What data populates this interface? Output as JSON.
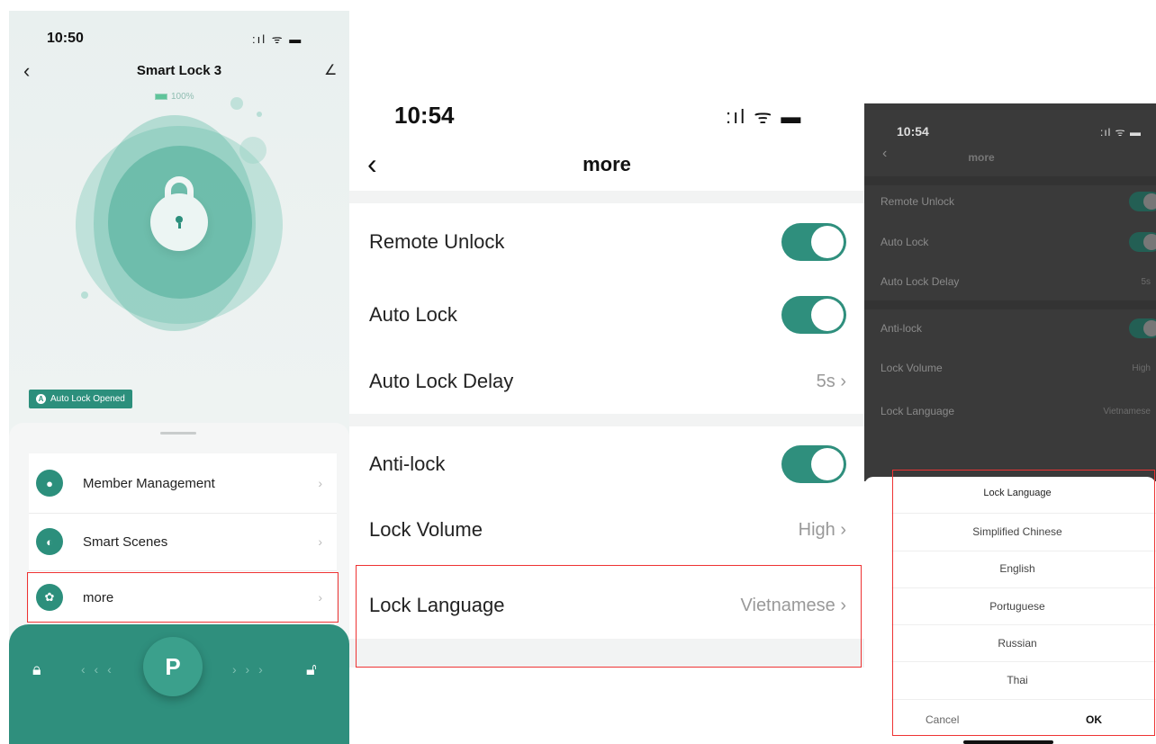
{
  "panel1": {
    "status_time": "10:50",
    "status_icons": ":ıl ᯤ ▬",
    "title": "Smart Lock 3",
    "battery": "100%",
    "auto_lock_badge": "Auto Lock Opened",
    "menu": [
      {
        "label": "Member Management",
        "icon": "person-icon"
      },
      {
        "label": "Smart Scenes",
        "icon": "toggle-icon"
      },
      {
        "label": "more",
        "icon": "gear-icon"
      }
    ],
    "bottom_bar": {
      "key_glyph": "P",
      "left_arrows": "‹ ‹ ‹",
      "right_arrows": "› › ›"
    },
    "colors": {
      "accent": "#2f8f7d",
      "highlight": "#e33333"
    }
  },
  "panel2": {
    "status_time": "10:54",
    "status_icons": ":ıl ᯤ ▬",
    "title": "more",
    "rows": [
      {
        "label": "Remote Unlock",
        "toggle": true
      },
      {
        "label": "Auto Lock",
        "toggle": true
      },
      {
        "label": "Auto Lock Delay",
        "value": "5s"
      },
      {
        "label": "Anti-lock",
        "toggle": true
      },
      {
        "label": "Lock Volume",
        "value": "High"
      },
      {
        "label": "Lock Language",
        "value": "Vietnamese"
      }
    ]
  },
  "panel3": {
    "status_time": "10:54",
    "status_icons": ":ıl ᯤ ▬",
    "title": "more",
    "rows": [
      {
        "label": "Remote Unlock",
        "toggle": true
      },
      {
        "label": "Auto Lock",
        "toggle": true
      },
      {
        "label": "Auto Lock Delay",
        "value": "5s"
      },
      {
        "label": "Anti-lock",
        "toggle": true
      },
      {
        "label": "Lock Volume",
        "value": "High"
      },
      {
        "label": "Lock Language",
        "value": "Vietnamese"
      }
    ],
    "picker": {
      "title": "Lock Language",
      "options": [
        "Simplified Chinese",
        "English",
        "Portuguese",
        "Russian",
        "Thai"
      ],
      "cancel": "Cancel",
      "ok": "OK"
    }
  }
}
